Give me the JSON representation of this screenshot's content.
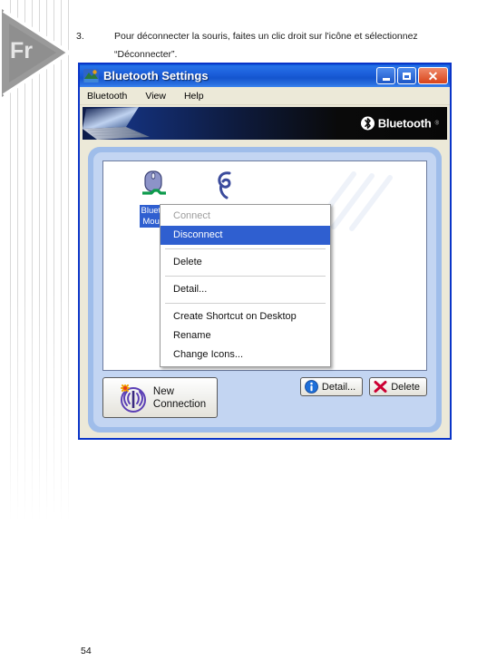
{
  "document": {
    "sidebar_tag": "Fr",
    "page_number": "54",
    "instruction": {
      "number": "3.",
      "text": "Pour déconnecter la souris, faites un clic droit sur l'icône et sélectionnez “Déconnecter”."
    }
  },
  "window": {
    "title": "Bluetooth Settings",
    "title_icon": "bluetooth-settings-icon",
    "controls": {
      "minimize": "minimize-button",
      "maximize": "maximize-button",
      "close": "close-button"
    },
    "menubar": [
      "Bluetooth",
      "View",
      "Help"
    ],
    "banner": {
      "brand": "Bluetooth",
      "trademark": "®",
      "mark_icon": "bluetooth-rune-icon"
    },
    "devices": [
      {
        "icon": "mouse-icon",
        "label": "Blueto\nMous",
        "selected": true
      },
      {
        "icon": "headset-icon",
        "label": "",
        "selected": false
      }
    ],
    "context_menu": [
      {
        "label": "Connect",
        "state": "disabled"
      },
      {
        "label": "Disconnect",
        "state": "selected"
      },
      {
        "separator": true
      },
      {
        "label": "Delete",
        "state": "normal"
      },
      {
        "separator": true
      },
      {
        "label": "Detail...",
        "state": "normal"
      },
      {
        "separator": true
      },
      {
        "label": "Create Shortcut on Desktop",
        "state": "normal"
      },
      {
        "label": "Rename",
        "state": "normal"
      },
      {
        "label": "Change Icons...",
        "state": "normal"
      }
    ],
    "buttons": {
      "new_connection": {
        "label": "New\nConnection",
        "icon": "new-connection-antenna-icon"
      },
      "detail": {
        "label": "Detail...",
        "icon": "info-icon"
      },
      "delete": {
        "label": "Delete",
        "icon": "red-x-icon"
      }
    }
  },
  "colors": {
    "titlebar_blue": "#1C5FDB",
    "selection_blue": "#2F5FD0",
    "window_border": "#0A35C8",
    "panel_outer": "#9FBDEA",
    "panel_inner": "#C3D5F2",
    "chrome_beige": "#ECE9D8",
    "close_red": "#D8441A",
    "delete_x_red": "#CC0033",
    "info_blue": "#1E6FD9"
  }
}
